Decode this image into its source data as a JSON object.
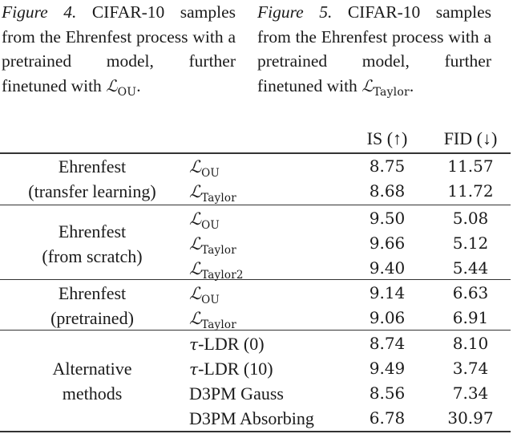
{
  "captions": [
    {
      "label": "Figure 4.",
      "text": "CIFAR-10 samples from the Ehrenfest process with a pretrained model, further finetuned with",
      "loss_symbol": "ℒ",
      "loss_subscript": "OU",
      "end": "."
    },
    {
      "label": "Figure 5.",
      "text": "CIFAR-10 samples from the Ehrenfest process with a pretrained model, further finetuned with",
      "loss_symbol": "ℒ",
      "loss_subscript": "Taylor",
      "end": "."
    }
  ],
  "table": {
    "headers": {
      "is": "IS (↑)",
      "fid": "FID (↓)"
    },
    "groups": [
      {
        "label_lines": [
          "Ehrenfest",
          "(transfer learning)"
        ],
        "rows": [
          {
            "method_symbol": "ℒ",
            "method_sub": "OU",
            "is": "8.75",
            "fid": "11.57"
          },
          {
            "method_symbol": "ℒ",
            "method_sub": "Taylor",
            "is": "8.68",
            "fid": "11.72"
          }
        ]
      },
      {
        "label_lines": [
          "Ehrenfest",
          "(from scratch)"
        ],
        "rows": [
          {
            "method_symbol": "ℒ",
            "method_sub": "OU",
            "is": "9.50",
            "fid": "5.08"
          },
          {
            "method_symbol": "ℒ",
            "method_sub": "Taylor",
            "is": "9.66",
            "fid": "5.12"
          },
          {
            "method_symbol": "ℒ",
            "method_sub": "Taylor2",
            "is": "9.40",
            "fid": "5.44"
          }
        ]
      },
      {
        "label_lines": [
          "Ehrenfest",
          "(pretrained)"
        ],
        "rows": [
          {
            "method_symbol": "ℒ",
            "method_sub": "OU",
            "is": "9.14",
            "fid": "6.63"
          },
          {
            "method_symbol": "ℒ",
            "method_sub": "Taylor",
            "is": "9.06",
            "fid": "6.91"
          }
        ]
      },
      {
        "label_lines": [
          "Alternative",
          "methods"
        ],
        "rows": [
          {
            "method_tau": "τ",
            "method_text": "-LDR (0)",
            "is": "8.74",
            "fid": "8.10"
          },
          {
            "method_tau": "τ",
            "method_text": "-LDR (10)",
            "is": "9.49",
            "fid": "3.74"
          },
          {
            "method_text": "D3PM Gauss",
            "is": "8.56",
            "fid": "7.34"
          },
          {
            "method_text": "D3PM Absorbing",
            "is": "6.78",
            "fid": "30.97"
          }
        ]
      }
    ]
  }
}
